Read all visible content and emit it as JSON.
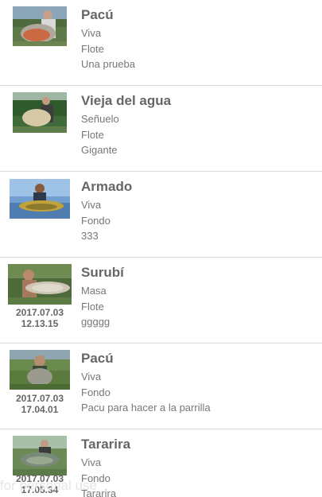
{
  "catches": [
    {
      "species": "Pacú",
      "bait": "Viva",
      "method": "Flote",
      "note": "Una prueba",
      "date": "",
      "time": ""
    },
    {
      "species": "Vieja del agua",
      "bait": "Señuelo",
      "method": "Flote",
      "note": "Gigante",
      "date": "",
      "time": ""
    },
    {
      "species": "Armado",
      "bait": "Viva",
      "method": "Fondo",
      "note": "333",
      "date": "",
      "time": ""
    },
    {
      "species": "Surubí",
      "bait": "Masa",
      "method": "Flote",
      "note": "ggggg",
      "date": "2017.07.03",
      "time": "12.13.15"
    },
    {
      "species": "Pacú",
      "bait": "Viva",
      "method": "Fondo",
      "note": "Pacu para hacer a la parrilla",
      "date": "2017.07.03",
      "time": "17.04.01"
    },
    {
      "species": "Tararira",
      "bait": "Viva",
      "method": "Fondo",
      "note": "Tararira",
      "date": "2017.07.03",
      "time": "17.05.34"
    }
  ],
  "watermark": "for personal use",
  "icons": {
    "thumbnail": "fish-catch-photo"
  },
  "colors": {
    "title": "#666666",
    "text": "#777777",
    "divider": "#dcdcdc"
  }
}
